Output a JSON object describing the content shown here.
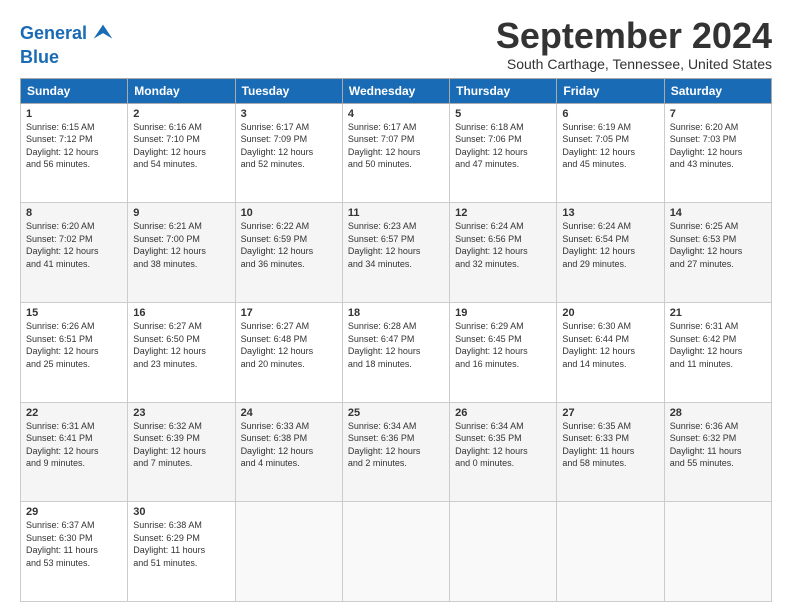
{
  "logo": {
    "line1": "General",
    "line2": "Blue"
  },
  "title": "September 2024",
  "subtitle": "South Carthage, Tennessee, United States",
  "days_header": [
    "Sunday",
    "Monday",
    "Tuesday",
    "Wednesday",
    "Thursday",
    "Friday",
    "Saturday"
  ],
  "weeks": [
    [
      {
        "day": "1",
        "info": "Sunrise: 6:15 AM\nSunset: 7:12 PM\nDaylight: 12 hours\nand 56 minutes."
      },
      {
        "day": "2",
        "info": "Sunrise: 6:16 AM\nSunset: 7:10 PM\nDaylight: 12 hours\nand 54 minutes."
      },
      {
        "day": "3",
        "info": "Sunrise: 6:17 AM\nSunset: 7:09 PM\nDaylight: 12 hours\nand 52 minutes."
      },
      {
        "day": "4",
        "info": "Sunrise: 6:17 AM\nSunset: 7:07 PM\nDaylight: 12 hours\nand 50 minutes."
      },
      {
        "day": "5",
        "info": "Sunrise: 6:18 AM\nSunset: 7:06 PM\nDaylight: 12 hours\nand 47 minutes."
      },
      {
        "day": "6",
        "info": "Sunrise: 6:19 AM\nSunset: 7:05 PM\nDaylight: 12 hours\nand 45 minutes."
      },
      {
        "day": "7",
        "info": "Sunrise: 6:20 AM\nSunset: 7:03 PM\nDaylight: 12 hours\nand 43 minutes."
      }
    ],
    [
      {
        "day": "8",
        "info": "Sunrise: 6:20 AM\nSunset: 7:02 PM\nDaylight: 12 hours\nand 41 minutes."
      },
      {
        "day": "9",
        "info": "Sunrise: 6:21 AM\nSunset: 7:00 PM\nDaylight: 12 hours\nand 38 minutes."
      },
      {
        "day": "10",
        "info": "Sunrise: 6:22 AM\nSunset: 6:59 PM\nDaylight: 12 hours\nand 36 minutes."
      },
      {
        "day": "11",
        "info": "Sunrise: 6:23 AM\nSunset: 6:57 PM\nDaylight: 12 hours\nand 34 minutes."
      },
      {
        "day": "12",
        "info": "Sunrise: 6:24 AM\nSunset: 6:56 PM\nDaylight: 12 hours\nand 32 minutes."
      },
      {
        "day": "13",
        "info": "Sunrise: 6:24 AM\nSunset: 6:54 PM\nDaylight: 12 hours\nand 29 minutes."
      },
      {
        "day": "14",
        "info": "Sunrise: 6:25 AM\nSunset: 6:53 PM\nDaylight: 12 hours\nand 27 minutes."
      }
    ],
    [
      {
        "day": "15",
        "info": "Sunrise: 6:26 AM\nSunset: 6:51 PM\nDaylight: 12 hours\nand 25 minutes."
      },
      {
        "day": "16",
        "info": "Sunrise: 6:27 AM\nSunset: 6:50 PM\nDaylight: 12 hours\nand 23 minutes."
      },
      {
        "day": "17",
        "info": "Sunrise: 6:27 AM\nSunset: 6:48 PM\nDaylight: 12 hours\nand 20 minutes."
      },
      {
        "day": "18",
        "info": "Sunrise: 6:28 AM\nSunset: 6:47 PM\nDaylight: 12 hours\nand 18 minutes."
      },
      {
        "day": "19",
        "info": "Sunrise: 6:29 AM\nSunset: 6:45 PM\nDaylight: 12 hours\nand 16 minutes."
      },
      {
        "day": "20",
        "info": "Sunrise: 6:30 AM\nSunset: 6:44 PM\nDaylight: 12 hours\nand 14 minutes."
      },
      {
        "day": "21",
        "info": "Sunrise: 6:31 AM\nSunset: 6:42 PM\nDaylight: 12 hours\nand 11 minutes."
      }
    ],
    [
      {
        "day": "22",
        "info": "Sunrise: 6:31 AM\nSunset: 6:41 PM\nDaylight: 12 hours\nand 9 minutes."
      },
      {
        "day": "23",
        "info": "Sunrise: 6:32 AM\nSunset: 6:39 PM\nDaylight: 12 hours\nand 7 minutes."
      },
      {
        "day": "24",
        "info": "Sunrise: 6:33 AM\nSunset: 6:38 PM\nDaylight: 12 hours\nand 4 minutes."
      },
      {
        "day": "25",
        "info": "Sunrise: 6:34 AM\nSunset: 6:36 PM\nDaylight: 12 hours\nand 2 minutes."
      },
      {
        "day": "26",
        "info": "Sunrise: 6:34 AM\nSunset: 6:35 PM\nDaylight: 12 hours\nand 0 minutes."
      },
      {
        "day": "27",
        "info": "Sunrise: 6:35 AM\nSunset: 6:33 PM\nDaylight: 11 hours\nand 58 minutes."
      },
      {
        "day": "28",
        "info": "Sunrise: 6:36 AM\nSunset: 6:32 PM\nDaylight: 11 hours\nand 55 minutes."
      }
    ],
    [
      {
        "day": "29",
        "info": "Sunrise: 6:37 AM\nSunset: 6:30 PM\nDaylight: 11 hours\nand 53 minutes."
      },
      {
        "day": "30",
        "info": "Sunrise: 6:38 AM\nSunset: 6:29 PM\nDaylight: 11 hours\nand 51 minutes."
      },
      {
        "day": "",
        "info": ""
      },
      {
        "day": "",
        "info": ""
      },
      {
        "day": "",
        "info": ""
      },
      {
        "day": "",
        "info": ""
      },
      {
        "day": "",
        "info": ""
      }
    ]
  ]
}
